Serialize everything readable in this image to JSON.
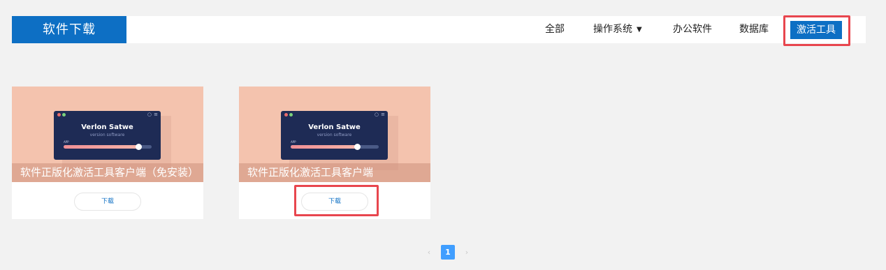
{
  "header": {
    "brand": "软件下载",
    "nav": [
      {
        "label": "全部"
      },
      {
        "label": "操作系统",
        "has_dropdown": true
      },
      {
        "label": "办公软件"
      },
      {
        "label": "数据库"
      },
      {
        "label": "激活工具",
        "active": true
      }
    ]
  },
  "cards": [
    {
      "image": {
        "app_title": "Verlon Satwe",
        "app_subtitle": "version software",
        "app_label": "APP",
        "progress": 0.85
      },
      "caption": "软件正版化激活工具客户端（免安装）",
      "download_label": "下载"
    },
    {
      "image": {
        "app_title": "Verlon Satwe",
        "app_subtitle": "version software",
        "app_label": "APP",
        "progress": 0.75
      },
      "caption": "软件正版化激活工具客户端",
      "download_label": "下载"
    }
  ],
  "pagination": {
    "prev": "‹",
    "current": "1",
    "next": "›"
  },
  "colors": {
    "brand": "#0d6fc4",
    "highlight": "#e8464e",
    "page_active": "#409eff",
    "thumb_bg": "#f4c3ae"
  }
}
